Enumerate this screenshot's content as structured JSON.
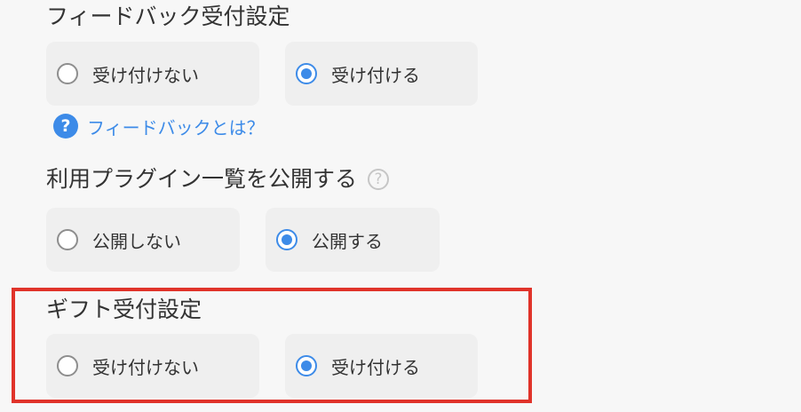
{
  "feedback": {
    "title": "フィードバック受付設定",
    "option_off": "受け付けない",
    "option_on": "受け付ける",
    "selected": "option_on",
    "help_icon": "question-circle-icon",
    "help_link": "フィードバックとは？",
    "help_icon_glyph": "?"
  },
  "plugins": {
    "title": "利用プラグイン一覧を公開する",
    "help_icon": "question-circle-outline-icon",
    "help_icon_glyph": "?",
    "option_off": "公開しない",
    "option_on": "公開する",
    "selected": "option_on"
  },
  "gift": {
    "title": "ギフト受付設定",
    "option_off": "受け付けない",
    "option_on": "受け付ける",
    "selected": "option_on"
  },
  "colors": {
    "accent": "#3d8be8",
    "highlight_border": "#e0332a",
    "background": "#f7f7f7",
    "card": "#efefef"
  }
}
